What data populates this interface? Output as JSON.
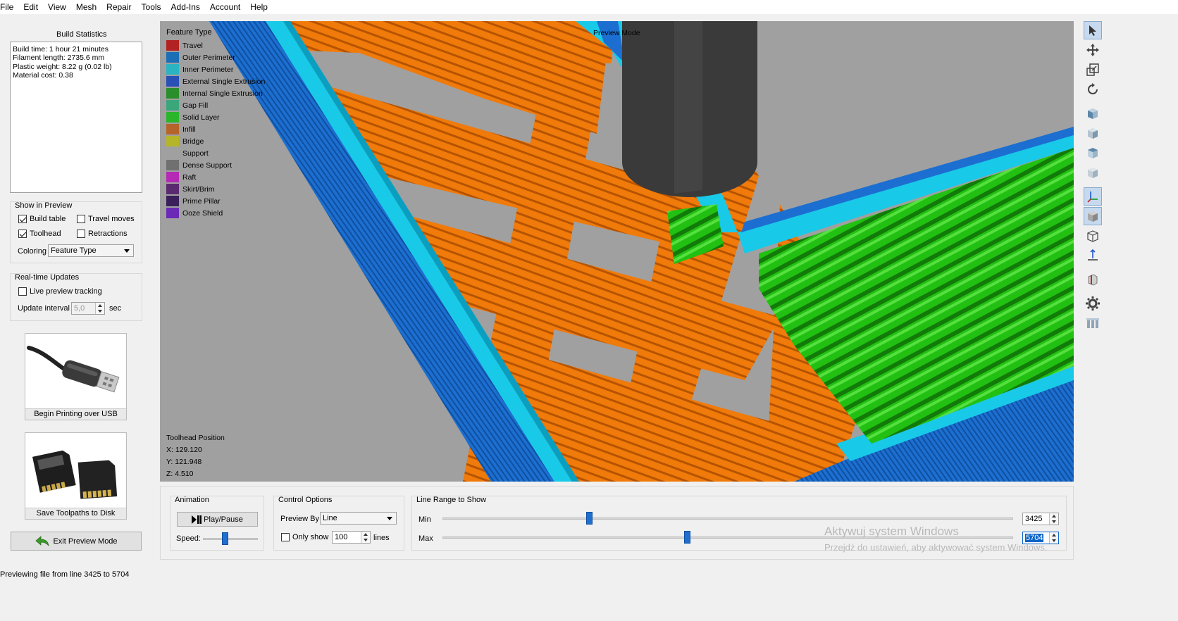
{
  "menu": [
    "File",
    "Edit",
    "View",
    "Mesh",
    "Repair",
    "Tools",
    "Add-Ins",
    "Account",
    "Help"
  ],
  "build_stats": {
    "title": "Build Statistics",
    "lines": [
      "Build time: 1 hour 21 minutes",
      "Filament length: 2735.6 mm",
      "Plastic weight: 8.22 g (0.02 lb)",
      "Material cost: 0.38"
    ]
  },
  "show_in_preview": {
    "title": "Show in Preview",
    "build_table": {
      "label": "Build table",
      "checked": true
    },
    "travel_moves": {
      "label": "Travel moves",
      "checked": false
    },
    "toolhead": {
      "label": "Toolhead",
      "checked": true
    },
    "retractions": {
      "label": "Retractions",
      "checked": false
    },
    "coloring_label": "Coloring",
    "coloring_value": "Feature Type"
  },
  "realtime": {
    "title": "Real-time Updates",
    "live_tracking": {
      "label": "Live preview tracking",
      "checked": false
    },
    "interval_label": "Update interval",
    "interval_value": "5,0",
    "interval_unit": "sec"
  },
  "usb_button": {
    "label": "Begin Printing over USB"
  },
  "disk_button": {
    "label": "Save Toolpaths to Disk"
  },
  "exit_button": {
    "label": "Exit Preview Mode"
  },
  "viewport": {
    "legend_title": "Feature Type",
    "preview_mode": "Preview Mode",
    "legend": [
      {
        "label": "Travel",
        "color": "#b22222"
      },
      {
        "label": "Outer Perimeter",
        "color": "#1c6fb5"
      },
      {
        "label": "Inner Perimeter",
        "color": "#2bb3c2"
      },
      {
        "label": "External Single Extrusion",
        "color": "#2a4fb5"
      },
      {
        "label": "Internal Single Extrusion",
        "color": "#2a8f2a"
      },
      {
        "label": "Gap Fill",
        "color": "#3aa77a"
      },
      {
        "label": "Solid Layer",
        "color": "#2ab52a"
      },
      {
        "label": "Infill",
        "color": "#b5642a"
      },
      {
        "label": "Bridge",
        "color": "#b5b52a"
      },
      {
        "label": "Support",
        "color": "#a0a0a0"
      },
      {
        "label": "Dense Support",
        "color": "#707070"
      },
      {
        "label": "Raft",
        "color": "#b52ab5"
      },
      {
        "label": "Skirt/Brim",
        "color": "#5a2a6f"
      },
      {
        "label": "Prime Pillar",
        "color": "#3a1f5a"
      },
      {
        "label": "Ooze Shield",
        "color": "#6a2ab5"
      }
    ],
    "toolhead_title": "Toolhead Position",
    "x": "X: 129.120",
    "y": "Y: 121.948",
    "z": "Z: 4.510"
  },
  "animation": {
    "title": "Animation",
    "play_label": "Play/Pause",
    "speed_label": "Speed:",
    "speed_fraction": 0.4
  },
  "control": {
    "title": "Control Options",
    "preview_by_label": "Preview By",
    "preview_by_value": "Line",
    "only_show_label": "Only show",
    "only_show_checked": false,
    "only_show_value": "100",
    "lines_label": "lines"
  },
  "line_range": {
    "title": "Line Range to Show",
    "min_label": "Min",
    "max_label": "Max",
    "min_value": "3425",
    "max_value": "5704",
    "min_fraction": 0.257,
    "max_fraction": 0.428
  },
  "watermark": {
    "line1": "Aktywuj system Windows",
    "line2": "Przejdź do ustawień, aby aktywować system Windows."
  },
  "status": "Previewing file from line 3425 to 5704"
}
